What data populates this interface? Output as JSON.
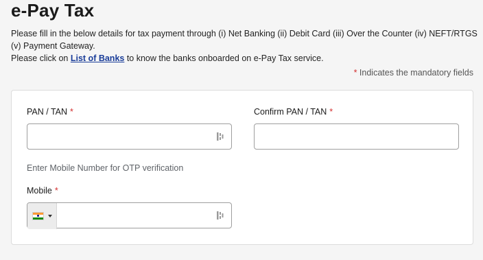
{
  "page": {
    "title": "e-Pay Tax",
    "intro_line1": "Please fill in the below details for tax payment through (i) Net Banking (ii) Debit Card (iii) Over the Counter (iv) NEFT/RTGS (v) Payment Gateway.",
    "intro_line2_prefix": "Please click on ",
    "intro_link": "List of Banks",
    "intro_line2_suffix": " to know the banks onboarded on e-Pay Tax service.",
    "mandatory_star": "*",
    "mandatory_note": " Indicates the mandatory fields"
  },
  "form": {
    "pan": {
      "label": "PAN / TAN",
      "required": "*",
      "value": "",
      "placeholder": "",
      "icon": "keyboard-icon"
    },
    "confirm_pan": {
      "label": "Confirm PAN / TAN",
      "required": "*",
      "value": "",
      "placeholder": ""
    },
    "otp_helper": "Enter Mobile Number for OTP verification",
    "mobile": {
      "label": "Mobile",
      "required": "*",
      "value": "",
      "placeholder": "",
      "country_flag": "india-flag-icon",
      "icon": "keyboard-icon"
    }
  },
  "colors": {
    "background": "#f5f5f5",
    "link": "#1a3d99",
    "required_star": "#d32f2f",
    "input_border": "#9e9e9e"
  }
}
